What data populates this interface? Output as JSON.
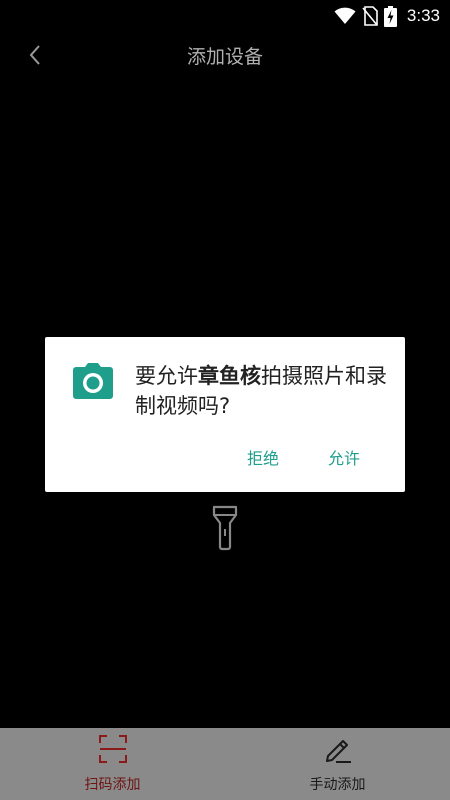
{
  "status_bar": {
    "time": "3:33",
    "icons": [
      "wifi-icon",
      "no-sim-icon",
      "battery-charging-icon"
    ]
  },
  "header": {
    "back_icon": "chevron-left-icon",
    "title": "添加设备"
  },
  "scanner": {
    "flashlight_icon": "flashlight-icon"
  },
  "permission_dialog": {
    "icon": "camera-icon",
    "message_prefix": "要允许",
    "app_name": "章鱼核",
    "message_suffix": "拍摄照片和录制视频吗?",
    "deny_label": "拒绝",
    "allow_label": "允许",
    "accent_color": "#1f9e8c"
  },
  "bottom_bar": {
    "tabs": [
      {
        "label": "扫码添加",
        "icon": "scan-icon",
        "active": true
      },
      {
        "label": "手动添加",
        "icon": "pencil-icon",
        "active": false
      }
    ],
    "active_color": "#8b1a1a"
  }
}
